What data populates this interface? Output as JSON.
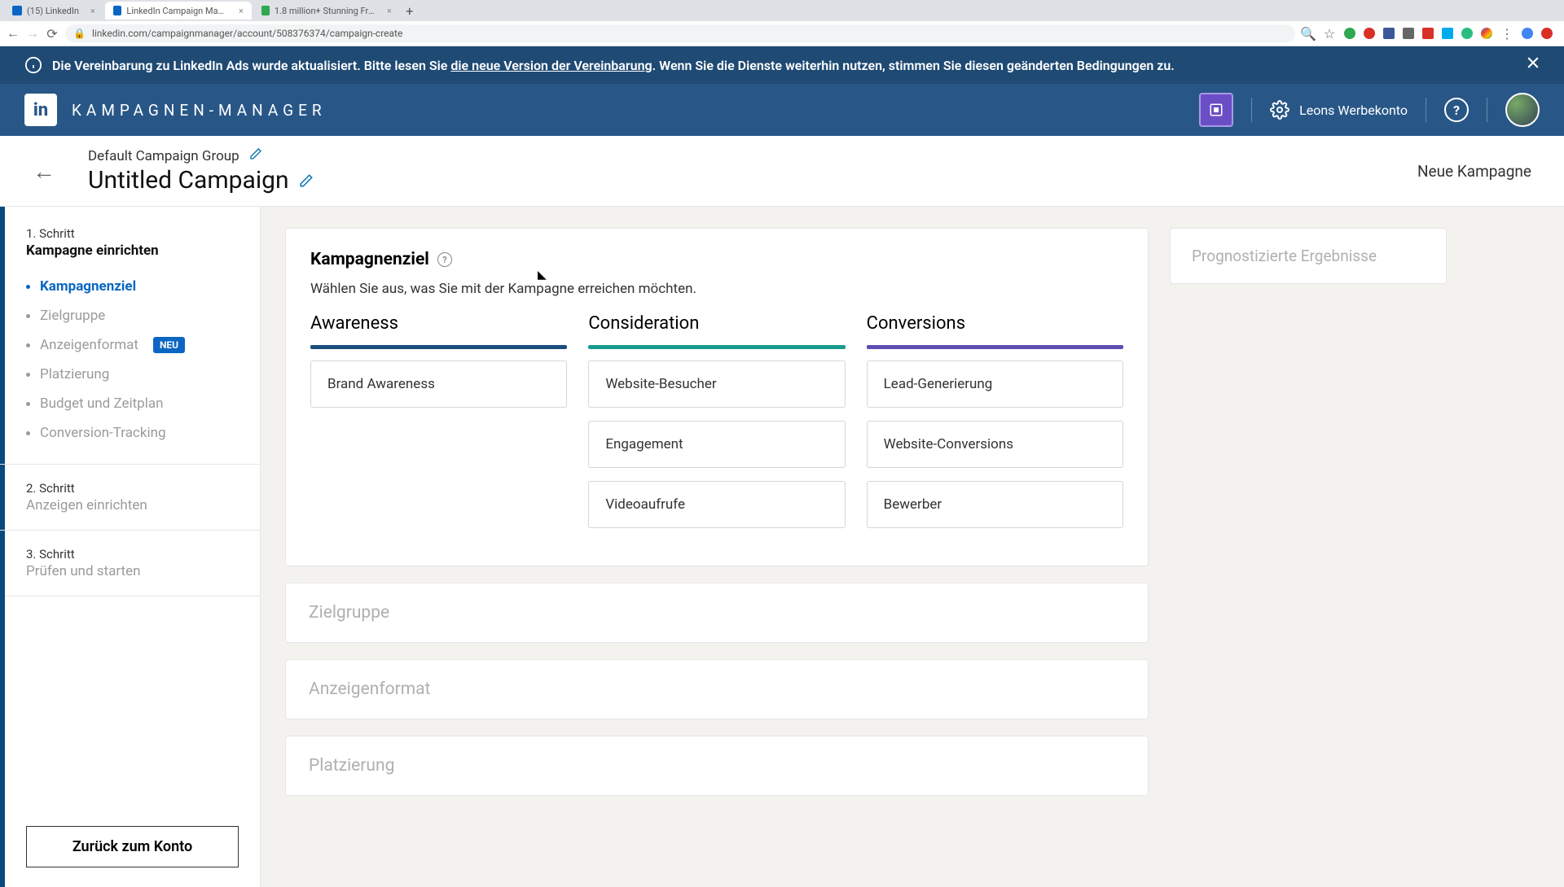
{
  "browser": {
    "tabs": [
      {
        "label": "(15) LinkedIn",
        "active": false,
        "fav": "#0a66c2"
      },
      {
        "label": "LinkedIn Campaign Manager",
        "active": true,
        "fav": "#0a66c2"
      },
      {
        "label": "1.8 million+ Stunning Free Ima",
        "active": false,
        "fav": "#2fa84f"
      }
    ],
    "url": "linkedin.com/campaignmanager/account/508376374/campaign-create"
  },
  "banner": {
    "prefix": "Die Vereinbarung zu LinkedIn Ads wurde aktualisiert. Bitte lesen Sie ",
    "link": "die neue Version der Vereinbarung",
    "suffix": ". Wenn Sie die Dienste weiterhin nutzen, stimmen Sie diesen geänderten Bedingungen zu."
  },
  "topnav": {
    "app_title": "KAMPAGNEN-MANAGER",
    "account_name": "Leons Werbekonto"
  },
  "campaign_header": {
    "group": "Default Campaign Group",
    "title": "Untitled Campaign",
    "right_label": "Neue Kampagne"
  },
  "sidebar": {
    "steps": [
      {
        "label": "1. Schritt",
        "title": "Kampagne einrichten",
        "active": true,
        "items": [
          {
            "label": "Kampagnenziel",
            "active": true
          },
          {
            "label": "Zielgruppe"
          },
          {
            "label": "Anzeigenformat",
            "badge": "NEU"
          },
          {
            "label": "Platzierung"
          },
          {
            "label": "Budget und Zeitplan"
          },
          {
            "label": "Conversion-Tracking"
          }
        ]
      },
      {
        "label": "2. Schritt",
        "title": "Anzeigen einrichten"
      },
      {
        "label": "3. Schritt",
        "title": "Prüfen und starten"
      }
    ],
    "back_button": "Zurück zum Konto"
  },
  "objective": {
    "title": "Kampagnenziel",
    "subtitle": "Wählen Sie aus, was Sie mit der Kampagne erreichen möchten.",
    "columns": [
      {
        "heading": "Awareness",
        "color": "blue",
        "options": [
          "Brand Awareness"
        ]
      },
      {
        "heading": "Consideration",
        "color": "teal",
        "options": [
          "Website-Besucher",
          "Engagement",
          "Videoaufrufe"
        ]
      },
      {
        "heading": "Conversions",
        "color": "purple",
        "options": [
          "Lead-Generierung",
          "Website-Conversions",
          "Bewerber"
        ]
      }
    ]
  },
  "collapsed_sections": [
    "Zielgruppe",
    "Anzeigenformat",
    "Platzierung"
  ],
  "forecast": {
    "title": "Prognostizierte Ergebnisse"
  }
}
